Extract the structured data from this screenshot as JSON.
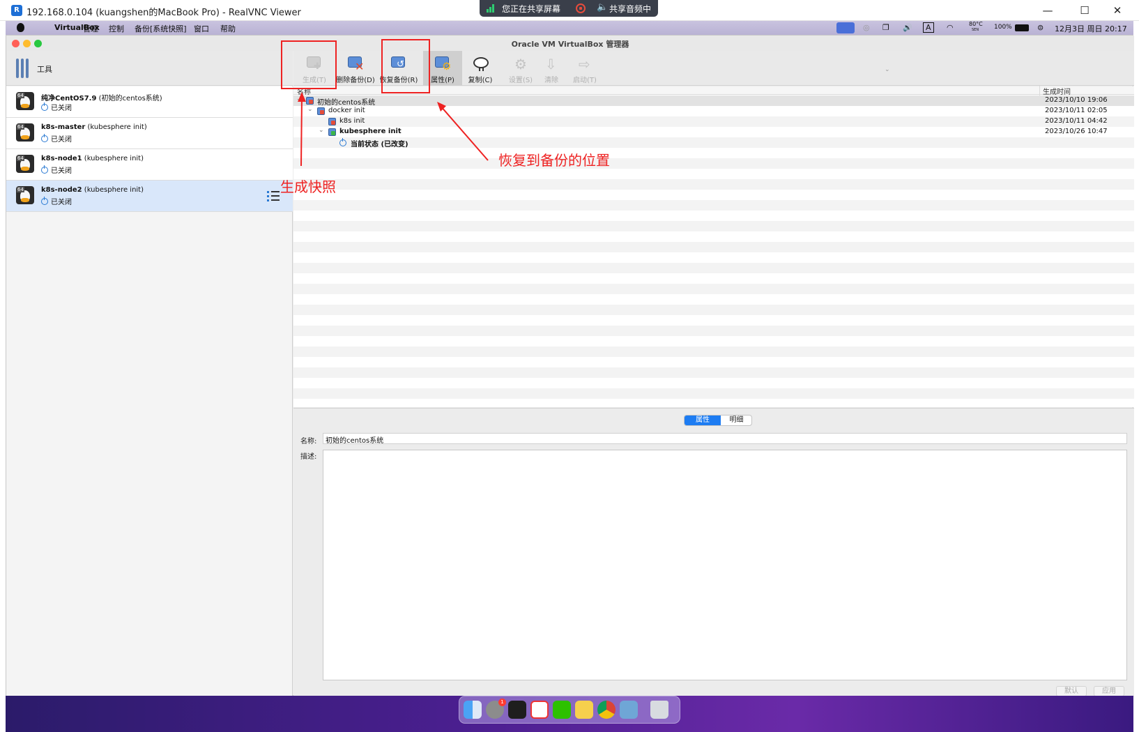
{
  "vnc": {
    "title": "192.168.0.104 (kuangshen的MacBook Pro) - RealVNC Viewer",
    "logo": "R"
  },
  "share_pill": {
    "sharing_label": "您正在共享屏幕",
    "audio_label": "共享音频中"
  },
  "mac_menu": {
    "items": [
      "VirtualBox",
      "管理",
      "控制",
      "备份[系统快照]",
      "窗口",
      "帮助"
    ],
    "status": {
      "temp": "80°C",
      "temp_sub": "SEN",
      "battery": "100%",
      "input_method": "A",
      "datetime": "12月3日 周日 20:17"
    }
  },
  "window": {
    "title": "Oracle VM VirtualBox 管理器"
  },
  "tools": {
    "label": "工具"
  },
  "vm_list": [
    {
      "name": "纯净CentOS7.9",
      "snapshot": "(初始的centos系统)",
      "status": "已关闭",
      "badge": "64"
    },
    {
      "name": "k8s-master",
      "snapshot": "(kubesphere init)",
      "status": "已关闭",
      "badge": "64"
    },
    {
      "name": "k8s-node1",
      "snapshot": "(kubesphere init)",
      "status": "已关闭",
      "badge": "64"
    },
    {
      "name": "k8s-node2",
      "snapshot": "(kubesphere init)",
      "status": "已关闭",
      "badge": "64"
    }
  ],
  "toolbar": {
    "take": "生成(T)",
    "delete": "删除备份(D)",
    "restore": "恢复备份(R)",
    "properties": "属性(P)",
    "clone": "复制(C)",
    "settings": "设置(S)",
    "discard": "清除",
    "start": "启动(T)"
  },
  "tree": {
    "col_name": "名称",
    "col_time": "生成时间",
    "rows": [
      {
        "label": "初始的centos系统",
        "time": "2023/10/10 19:06"
      },
      {
        "label": "docker init",
        "time": "2023/10/11 02:05"
      },
      {
        "label": "k8s init",
        "time": "2023/10/11 04:42"
      },
      {
        "label": "kubesphere init",
        "time": "2023/10/26 10:47"
      },
      {
        "label": "当前状态 (已改变)",
        "time": ""
      }
    ]
  },
  "details": {
    "tab_attributes": "属性",
    "tab_details": "明细",
    "name_label": "名称:",
    "name_value": "初始的centos系统",
    "desc_label": "描述:",
    "btn_default": "默认",
    "btn_apply": "应用"
  },
  "annotations": {
    "take_snapshot": "生成快照",
    "restore_position": "恢复到备份的位置"
  },
  "colors": {
    "annotation_red": "#ee2222",
    "selected_row": "#d9e7fa",
    "segment_active": "#1d7cf2"
  },
  "dock": {
    "badge_count": "1",
    "apps": [
      "finder-icon",
      "system-settings-icon",
      "terminal-icon",
      "wps-icon",
      "wechat-icon",
      "music-icon",
      "chrome-icon",
      "virtualbox-icon",
      "trash-icon"
    ]
  }
}
